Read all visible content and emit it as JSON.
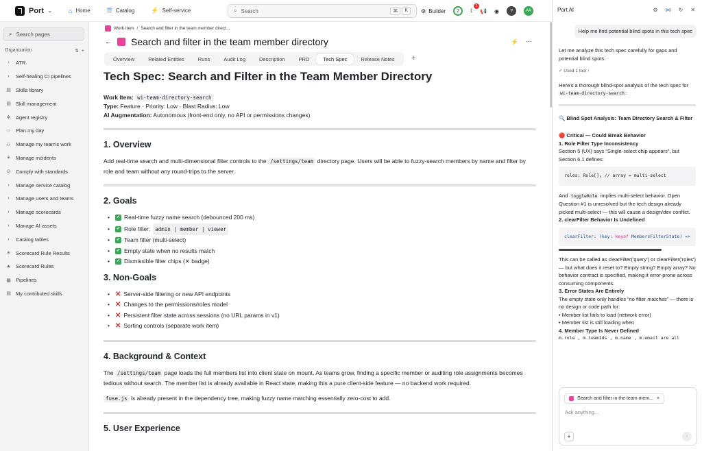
{
  "topbar": {
    "brand": "Port",
    "nav": [
      {
        "icon": "home-icon",
        "glyph": "⌂",
        "label": "Home"
      },
      {
        "icon": "catalog-icon",
        "glyph": "☰",
        "label": "Catalog"
      },
      {
        "icon": "bolt-icon",
        "glyph": "⚡",
        "label": "Self-service"
      }
    ],
    "search_placeholder": "Search",
    "kbd": [
      "⌘",
      "K"
    ],
    "builder": "Builder",
    "avatar": "AA",
    "badge": "1"
  },
  "sidebar": {
    "search": "Search pages",
    "section": "Organization",
    "items": [
      {
        "glyph": "›",
        "label": "ATR"
      },
      {
        "glyph": "›",
        "label": "Self-healing CI pipelines"
      },
      {
        "glyph": "▤",
        "label": "Skills library"
      },
      {
        "glyph": "▤",
        "label": "Skill management"
      },
      {
        "glyph": "✲",
        "label": "Agent registry"
      },
      {
        "glyph": "☼",
        "label": "Plan my day"
      },
      {
        "glyph": "⚇",
        "label": "Manage my team's work"
      },
      {
        "glyph": "✳",
        "label": "Manage incidents"
      },
      {
        "glyph": "◎",
        "label": "Comply with standards"
      },
      {
        "glyph": "›",
        "label": "Manage service catalog"
      },
      {
        "glyph": "›",
        "label": "Manage users and teams"
      },
      {
        "glyph": "›",
        "label": "Manage scorecards"
      },
      {
        "glyph": "›",
        "label": "Manage AI assets"
      },
      {
        "glyph": "›",
        "label": "Catalog tables"
      },
      {
        "glyph": "✳",
        "label": "Scorecard Rule Results"
      },
      {
        "glyph": "★",
        "label": "Scorecard Rules"
      },
      {
        "glyph": "▦",
        "label": "Pipelines"
      },
      {
        "glyph": "▤",
        "label": "My contributed skills"
      }
    ]
  },
  "main": {
    "crumb_root": "Work Item",
    "crumb_current": "Search and filter in the team member direct...",
    "title": "Search and filter in the team member directory",
    "tabs": [
      "Overview",
      "Related Entities",
      "Runs",
      "Audit Log",
      "Description",
      "PRD",
      "Tech Spec",
      "Release Notes"
    ],
    "active_tab": "Tech Spec"
  },
  "doc": {
    "h1": "Tech Spec: Search and Filter in the Team Member Directory",
    "work_item_label": "Work Item:",
    "work_item_value": "wi-team-directory-search",
    "type_label": "Type:",
    "type_value": "Feature · Priority: Low · Blast Radius: Low",
    "ai_label": "AI Augmentation:",
    "ai_value": "Autonomous (front-end only, no API or permissions changes)",
    "overview_h": "1. Overview",
    "overview_p1": "Add real-time search and multi-dimensional filter controls to the",
    "overview_code": "/settings/team",
    "overview_p2": "directory page. Users will be able to fuzzy-search members by name and filter by role and team without any round-trips to the server.",
    "goals_h": "2. Goals",
    "goals": [
      "Real-time fuzzy name search (debounced 200 ms)",
      "Role filter:",
      "Team filter (multi-select)",
      "Empty state when no results match",
      "Dismissible filter chips (✕ badge)"
    ],
    "roles_code": "admin | member | viewer",
    "nongoals_h": "3. Non-Goals",
    "nongoals": [
      "Server-side filtering or new API endpoints",
      "Changes to the permissions/roles model",
      "Persistent filter state across sessions (no URL params in v1)",
      "Sorting controls (separate work item)"
    ],
    "bg_h": "4. Background & Context",
    "bg_p0": "The",
    "bg_code": "/settings/team",
    "bg_p1": "page loads the full members list into client state on mount. As teams grow, finding a specific member or auditing role assignments becomes tedious without search. The member list is already available in React state, making this a pure client-side feature — no backend work required.",
    "fuse_code": "fuse.js",
    "fuse_p": "is already present in the dependency tree, making fuzzy name matching essentially zero-cost to add.",
    "ux_h": "5. User Experience"
  },
  "ai": {
    "title": "Port AI",
    "user_msg": "Help me find potential blind spots in this tech spec",
    "reply1": "Let me analyze this tech spec carefully for gaps and potential blind spots.",
    "tool": "✓ Used 1 tool ›",
    "reply2": "Here's a thorough blind-spot analysis of the tech spec for",
    "reply2_code": "wi-team-directory-search",
    "analysis_h": "🔍 Blind Spot Analysis: Team Directory Search & Filter",
    "critical": "🔴 Critical — Could Break Behavior",
    "item1": "1. Role Filter Type Inconsistency",
    "item1_p": "Section 5 (UX) says “Single-select chip appears”, but Section 6.1 defines:",
    "code1": "roles: Role[];  // array = multi-select",
    "p2a": "And",
    "p2code": "toggleRole",
    "p2b": "implies multi-select behavior. Open Question #1 is unresolved but the tech design already picked multi-select — this will cause a design/dev conflict.",
    "item2": "2. clearFilter Behavior Is Undefined",
    "code2a": "clearFilter: (key:",
    "code2kw": "keyof",
    "code2b": "MembersFilterState) =>",
    "p3": "This can be called as clearFilter('query') or clearFilter('roles') — but what does it reset to? Empty string? Empty array? No behavior contract is specified, making it error-prone across consuming components.",
    "item3": "3. Error States Are Entirely",
    "p4": "The empty state only handles “no filter matches” — there is no design or code path for:",
    "bullets": [
      "Member list fails to load (network error)",
      "Member list is still loading when"
    ],
    "item4": "4. Member Type Is Never Defined",
    "p5": "m.role , m.teamIds , m.name , m.email  are all",
    "chip": "Search and filter in the team mem...",
    "placeholder": "Ask anything..."
  }
}
